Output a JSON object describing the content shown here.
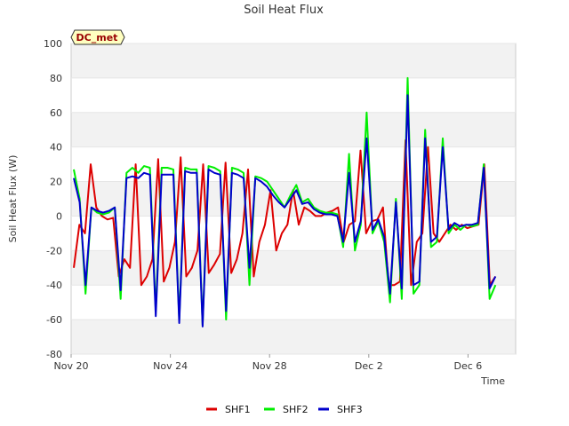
{
  "chart_data": {
    "type": "line",
    "title": "Soil Heat Flux",
    "xlabel": "Time",
    "ylabel": "Soil Heat Flux (W)",
    "badge": "DC_met",
    "x_unit": "days",
    "x_range": [
      "Nov 20",
      "Dec 7"
    ],
    "x_ticks": [
      "Nov 20",
      "Nov 24",
      "Nov 28",
      "Dec 2",
      "Dec 6"
    ],
    "ylim": [
      -80,
      100
    ],
    "y_ticks": [
      -80,
      -60,
      -40,
      -20,
      0,
      20,
      40,
      60,
      80,
      100
    ],
    "grid": "horizontal alternating bands",
    "legend_position": "bottom-center",
    "x_dates": [
      "Nov 20 00:00",
      "Nov 20 06:00",
      "Nov 20 12:00",
      "Nov 20 18:00",
      "Nov 21 00:00",
      "Nov 21 06:00",
      "Nov 21 12:00",
      "Nov 21 18:00",
      "Nov 22 00:00",
      "Nov 22 06:00",
      "Nov 22 12:00",
      "Nov 22 18:00",
      "Nov 23 00:00",
      "Nov 23 06:00",
      "Nov 23 12:00",
      "Nov 23 18:00",
      "Nov 24 00:00",
      "Nov 24 06:00",
      "Nov 24 12:00",
      "Nov 24 18:00",
      "Nov 25 00:00",
      "Nov 25 06:00",
      "Nov 25 12:00",
      "Nov 25 18:00",
      "Nov 26 00:00",
      "Nov 26 06:00",
      "Nov 26 12:00",
      "Nov 26 18:00",
      "Nov 27 00:00",
      "Nov 27 06:00",
      "Nov 27 12:00",
      "Nov 27 18:00",
      "Nov 28 00:00",
      "Nov 28 06:00",
      "Nov 28 12:00",
      "Nov 28 18:00",
      "Nov 29 00:00",
      "Nov 29 06:00",
      "Nov 29 12:00",
      "Nov 29 18:00",
      "Nov 30 00:00",
      "Nov 30 06:00",
      "Nov 30 12:00",
      "Nov 30 18:00",
      "Dec 1 00:00",
      "Dec 1 06:00",
      "Dec 1 12:00",
      "Dec 1 18:00",
      "Dec 2 00:00",
      "Dec 2 06:00",
      "Dec 2 12:00",
      "Dec 2 18:00",
      "Dec 3 00:00",
      "Dec 3 06:00",
      "Dec 3 12:00",
      "Dec 3 18:00",
      "Dec 4 00:00",
      "Dec 4 06:00",
      "Dec 4 12:00",
      "Dec 4 18:00",
      "Dec 5 00:00",
      "Dec 5 06:00",
      "Dec 5 12:00",
      "Dec 5 18:00",
      "Dec 6 00:00",
      "Dec 6 06:00",
      "Dec 6 12:00",
      "Dec 6 18:00",
      "Dec 7 00:00",
      "Dec 7 06:00"
    ],
    "series": [
      {
        "name": "SHF1",
        "color": "#dd0000",
        "values": [
          -30,
          -5,
          -10,
          30,
          5,
          0,
          -2,
          -1,
          -35,
          -25,
          -30,
          30,
          -40,
          -35,
          -25,
          33,
          -38,
          -30,
          -15,
          34,
          -35,
          -30,
          -20,
          30,
          -33,
          -28,
          -22,
          31,
          -33,
          -25,
          -10,
          27,
          -35,
          -15,
          -5,
          15,
          -20,
          -10,
          -5,
          15,
          -5,
          5,
          3,
          0,
          0,
          2,
          3,
          5,
          -15,
          -5,
          -3,
          38,
          -10,
          -3,
          -2,
          5,
          -40,
          -40,
          -38,
          44,
          -40,
          -15,
          -10,
          40,
          -10,
          -15,
          -10,
          -5,
          -8,
          -5,
          -7,
          -6,
          -5,
          30,
          -40,
          -35
        ]
      },
      {
        "name": "SHF2",
        "color": "#00ee00",
        "values": [
          27,
          10,
          -45,
          5,
          2,
          1,
          2,
          5,
          -48,
          25,
          28,
          25,
          29,
          28,
          -55,
          28,
          28,
          27,
          -60,
          28,
          27,
          27,
          -63,
          29,
          28,
          26,
          -60,
          28,
          27,
          25,
          -40,
          23,
          22,
          20,
          15,
          10,
          5,
          12,
          18,
          8,
          10,
          5,
          3,
          2,
          2,
          1,
          -18,
          36,
          -20,
          -5,
          60,
          -10,
          -3,
          -15,
          -50,
          10,
          -48,
          80,
          -45,
          -40,
          50,
          -18,
          -15,
          45,
          -10,
          -5,
          -8,
          -5,
          -6,
          -5,
          30,
          -48,
          -40
        ]
      },
      {
        "name": "SHF3",
        "color": "#0000cc",
        "values": [
          22,
          8,
          -40,
          5,
          3,
          2,
          3,
          5,
          -43,
          22,
          23,
          22,
          25,
          24,
          -58,
          24,
          24,
          24,
          -62,
          26,
          25,
          25,
          -64,
          27,
          25,
          24,
          -55,
          25,
          24,
          22,
          -30,
          22,
          20,
          17,
          12,
          8,
          5,
          10,
          15,
          7,
          8,
          4,
          2,
          1,
          1,
          0,
          -15,
          25,
          -15,
          -3,
          45,
          -8,
          -2,
          -12,
          -45,
          8,
          -42,
          70,
          -40,
          -38,
          45,
          -15,
          -12,
          40,
          -8,
          -4,
          -6,
          -5,
          -5,
          -4,
          28,
          -42,
          -35
        ]
      }
    ]
  }
}
